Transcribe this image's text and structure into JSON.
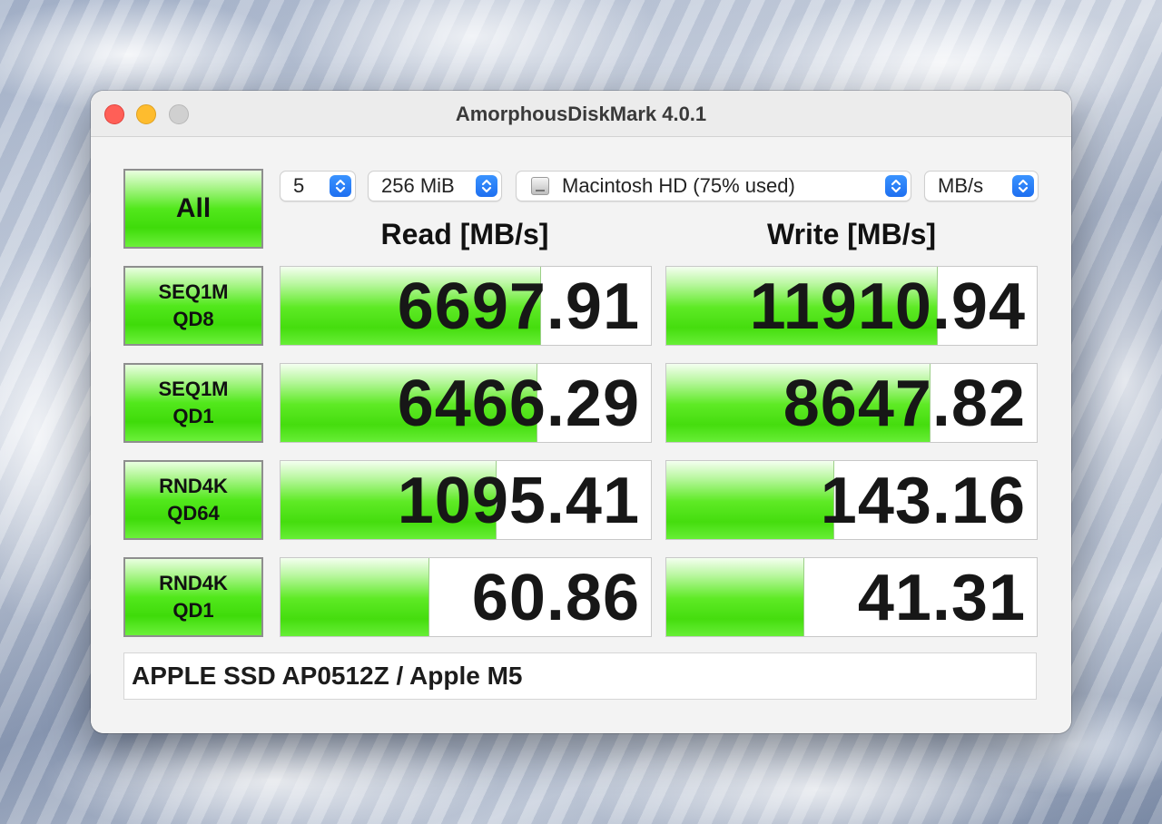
{
  "window": {
    "title": "AmorphousDiskMark 4.0.1"
  },
  "controls": {
    "all_label": "All",
    "count": "5",
    "size": "256 MiB",
    "disk": "Macintosh HD (75% used)",
    "unit": "MB/s"
  },
  "headers": {
    "read": "Read [MB/s]",
    "write": "Write [MB/s]"
  },
  "tests": [
    {
      "label": "SEQ1M\nQD8",
      "read": "6697.91",
      "write": "11910.94",
      "read_fill_pct": 70,
      "write_fill_pct": 73
    },
    {
      "label": "SEQ1M\nQD1",
      "read": "6466.29",
      "write": "8647.82",
      "read_fill_pct": 69,
      "write_fill_pct": 71
    },
    {
      "label": "RND4K\nQD64",
      "read": "1095.41",
      "write": "143.16",
      "read_fill_pct": 58,
      "write_fill_pct": 45
    },
    {
      "label": "RND4K\nQD1",
      "read": "60.86",
      "write": "41.31",
      "read_fill_pct": 40,
      "write_fill_pct": 37
    }
  ],
  "device_info": "APPLE SSD AP0512Z / Apple M5",
  "colors": {
    "accent_green": "#45dd0e",
    "select_chevron": "#1e6ff0",
    "traffic_close": "#ff5f57",
    "traffic_min": "#febc2e"
  }
}
